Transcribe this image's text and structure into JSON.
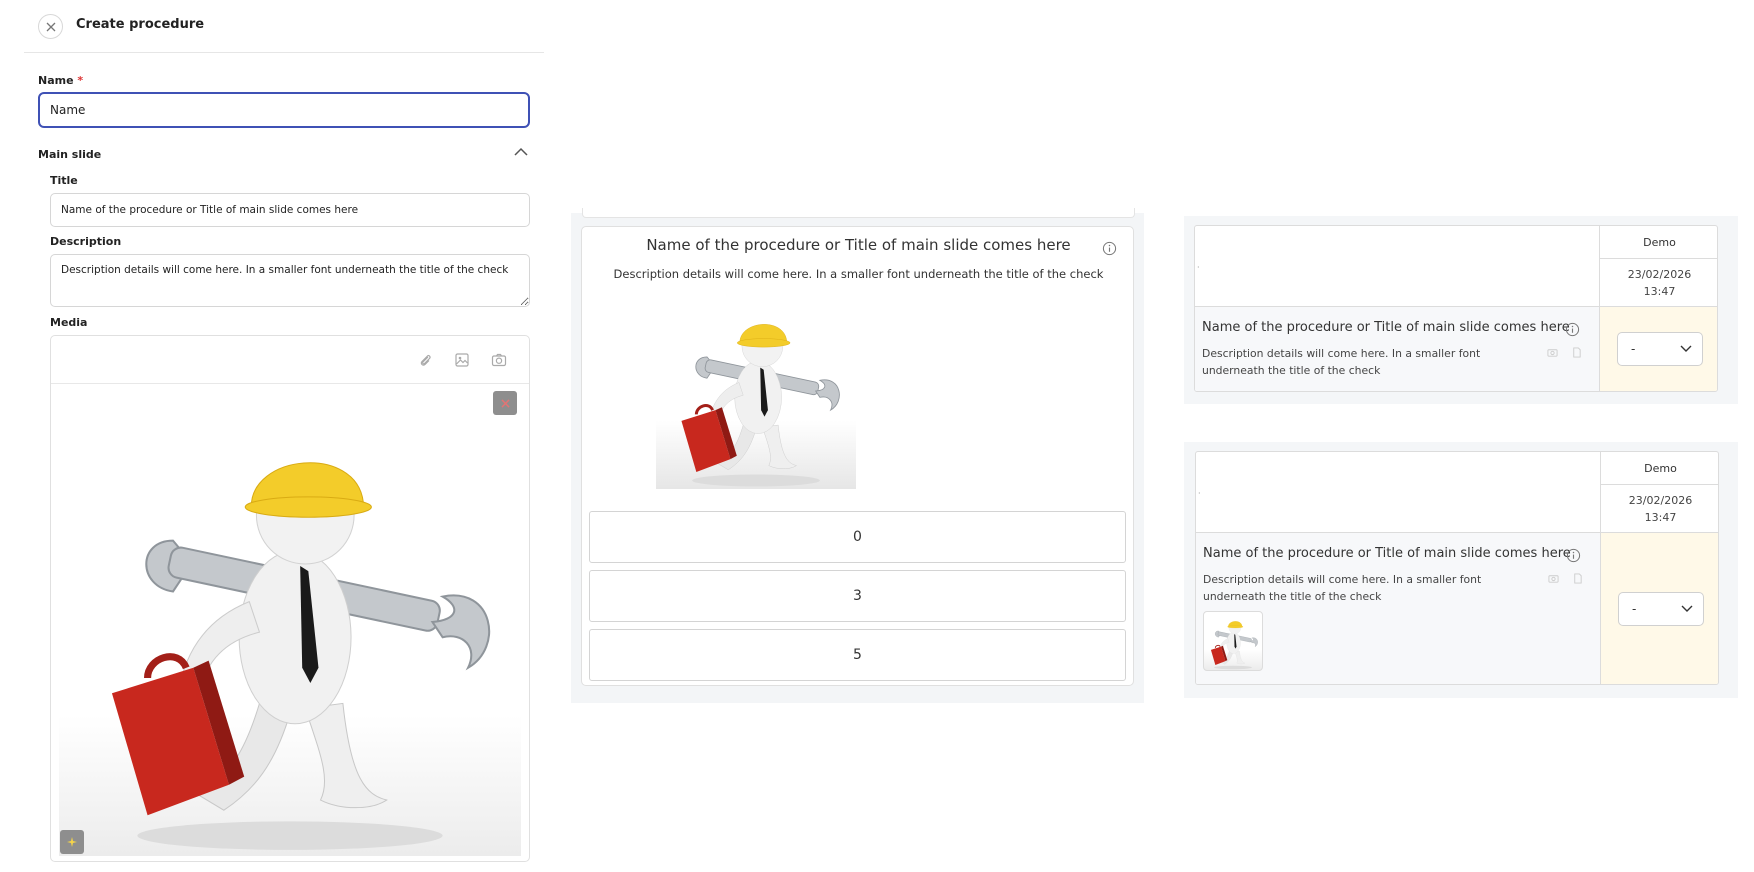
{
  "header": {
    "title": "Create procedure"
  },
  "form": {
    "name_label": "Name",
    "name_required": "*",
    "name_value": "Name",
    "section_title": "Main slide",
    "title_label": "Title",
    "title_value": "Name of the procedure or Title of main slide comes here",
    "description_label": "Description",
    "description_value": "Description details will come here. In a smaller font underneath the title of the check",
    "media_label": "Media"
  },
  "preview": {
    "title": "Name of the procedure or Title of main slide comes here",
    "description": "Description details will come here. In a smaller font underneath the title of the check",
    "options": [
      "0",
      "3",
      "5"
    ]
  },
  "tables": [
    {
      "column_header": "Demo",
      "date": "23/02/2026",
      "time": "13:47",
      "row_title": "Name of the procedure or Title of main slide comes here",
      "row_description": "Description details will come here. In a smaller font underneath the title of the check",
      "select_value": "-"
    },
    {
      "column_header": "Demo",
      "date": "23/02/2026",
      "time": "13:47",
      "row_title": "Name of the procedure or Title of main slide comes here",
      "row_description": "Description details will come here. In a smaller font underneath the title of the check",
      "select_value": "-"
    }
  ],
  "colors": {
    "accent": "#3f51b5",
    "yellow_cell": "#fff9e8",
    "preview_bg": "#f3f5f7"
  }
}
